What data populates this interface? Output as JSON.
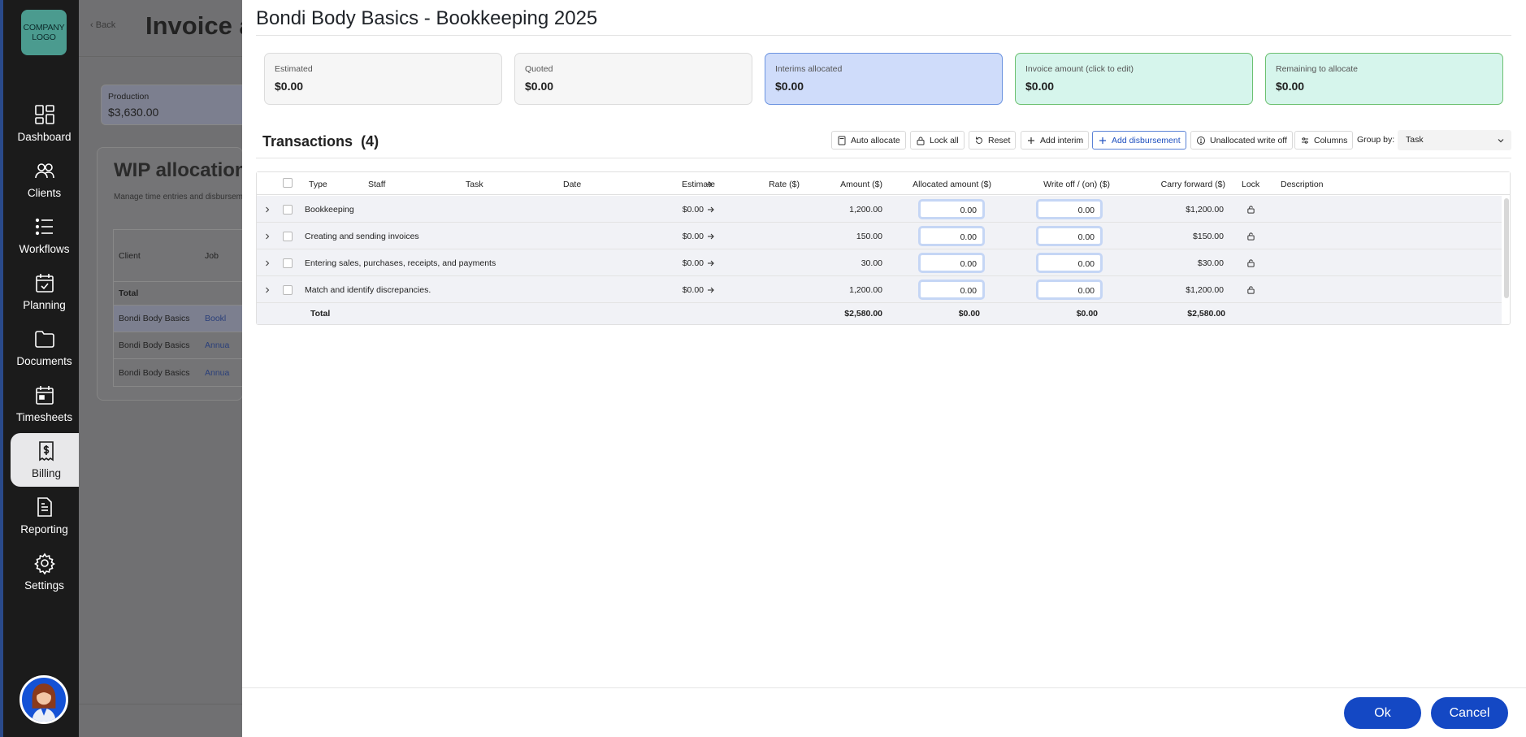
{
  "sidebar": {
    "logo_text_1": "COMPANY",
    "logo_text_2": "LOGO",
    "items": [
      {
        "label": "Dashboard",
        "icon": "dashboard-icon"
      },
      {
        "label": "Clients",
        "icon": "clients-icon"
      },
      {
        "label": "Workflows",
        "icon": "workflows-icon"
      },
      {
        "label": "Planning",
        "icon": "planning-icon"
      },
      {
        "label": "Documents",
        "icon": "documents-icon"
      },
      {
        "label": "Timesheets",
        "icon": "timesheets-icon"
      },
      {
        "label": "Billing",
        "icon": "billing-icon",
        "active": true
      },
      {
        "label": "Reporting",
        "icon": "reporting-icon"
      },
      {
        "label": "Settings",
        "icon": "settings-icon"
      }
    ]
  },
  "background_page": {
    "back_label": "Back",
    "title": "Invoice a",
    "production": {
      "label": "Production",
      "value": "$3,630.00"
    },
    "wip_title": "WIP allocation",
    "wip_subtitle": "Manage time entries and disbursem",
    "table": {
      "headers": [
        "Client",
        "Job"
      ],
      "total_label": "Total",
      "rows": [
        {
          "client": "Bondi Body Basics",
          "job": "Bookl"
        },
        {
          "client": "Bondi Body Basics",
          "job": "Annua"
        },
        {
          "client": "Bondi Body Basics",
          "job": "Annua"
        }
      ]
    }
  },
  "modal": {
    "title": "Bondi Body Basics - Bookkeeping 2025",
    "kpis": [
      {
        "label": "Estimated",
        "value": "$0.00",
        "style": "neutral"
      },
      {
        "label": "Quoted",
        "value": "$0.00",
        "style": "neutral"
      },
      {
        "label": "Interims allocated",
        "value": "$0.00",
        "style": "blue"
      },
      {
        "label": "Invoice amount  (click to edit)",
        "value": "$0.00",
        "style": "green"
      },
      {
        "label": "Remaining to allocate",
        "value": "$0.00",
        "style": "green"
      }
    ],
    "transactions_title": "Transactions",
    "transactions_count": "(4)",
    "toolbar": {
      "auto_allocate": "Auto allocate",
      "lock_all": "Lock all",
      "reset": "Reset",
      "add_interim": "Add interim",
      "add_disbursement": "Add disbursement",
      "unallocated_write_off": "Unallocated write off",
      "columns": "Columns",
      "group_by_label": "Group by:",
      "group_by_value": "Task"
    },
    "table": {
      "headers": {
        "type": "Type",
        "staff": "Staff",
        "task": "Task",
        "date": "Date",
        "estimate": "Estimate",
        "rate": "Rate ($)",
        "amount": "Amount ($)",
        "allocated": "Allocated amount ($)",
        "writeoff": "Write off / (on) ($)",
        "carry": "Carry forward ($)",
        "lock": "Lock",
        "description": "Description"
      },
      "rows": [
        {
          "type": "Bookkeeping",
          "estimate": "$0.00",
          "amount": "1,200.00",
          "allocated": "0.00",
          "writeoff": "0.00",
          "carry": "$1,200.00"
        },
        {
          "type": "Creating and sending invoices",
          "estimate": "$0.00",
          "amount": "150.00",
          "allocated": "0.00",
          "writeoff": "0.00",
          "carry": "$150.00"
        },
        {
          "type": "Entering sales, purchases, receipts, and payments",
          "estimate": "$0.00",
          "amount": "30.00",
          "allocated": "0.00",
          "writeoff": "0.00",
          "carry": "$30.00"
        },
        {
          "type": "Match and identify discrepancies.",
          "estimate": "$0.00",
          "amount": "1,200.00",
          "allocated": "0.00",
          "writeoff": "0.00",
          "carry": "$1,200.00"
        }
      ],
      "total": {
        "label": "Total",
        "amount": "$2,580.00",
        "allocated": "$0.00",
        "writeoff": "$0.00",
        "carry": "$2,580.00"
      }
    },
    "ok_label": "Ok",
    "cancel_label": "Cancel"
  },
  "colors": {
    "primary": "#1448c4",
    "sidebar": "#1b1b1b",
    "kpi_blue": "#cfdcfa",
    "kpi_green": "#d6f5ec",
    "row_bg": "#f1f2f6"
  }
}
